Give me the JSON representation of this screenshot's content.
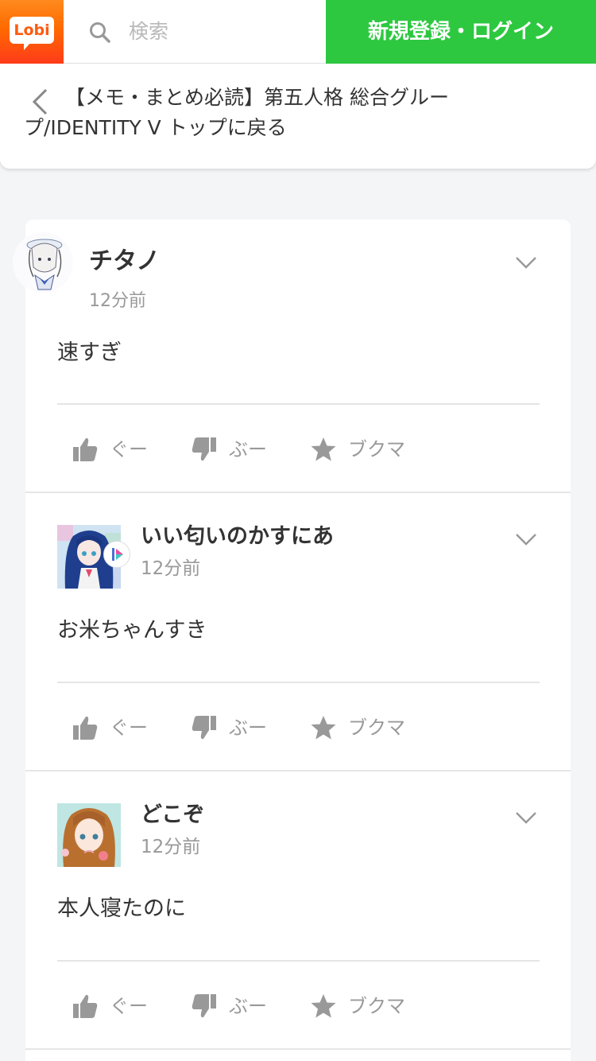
{
  "header": {
    "logo_text": "Lobi",
    "search_placeholder": "検索",
    "login_label": "新規登録・ログイン",
    "brand_color": "#ff6a00",
    "login_color": "#2dc840"
  },
  "breadcrumb": {
    "text": "【メモ・まとめ必読】第五人格 総合グループ/IDENTITY V トップに戻る"
  },
  "posts": [
    {
      "author": "チタノ",
      "time": "12分前",
      "body": "速すぎ",
      "actions": {
        "good": "ぐー",
        "boo": "ぶー",
        "bookmark": "ブクマ"
      }
    },
    {
      "author": "いい匂いのかすにあ",
      "time": "12分前",
      "body": "お米ちゃんすき",
      "actions": {
        "good": "ぐー",
        "boo": "ぶー",
        "bookmark": "ブクマ"
      }
    },
    {
      "author": "どこぞ",
      "time": "12分前",
      "body": "本人寝たのに",
      "actions": {
        "good": "ぐー",
        "boo": "ぶー",
        "bookmark": "ブクマ"
      }
    }
  ]
}
